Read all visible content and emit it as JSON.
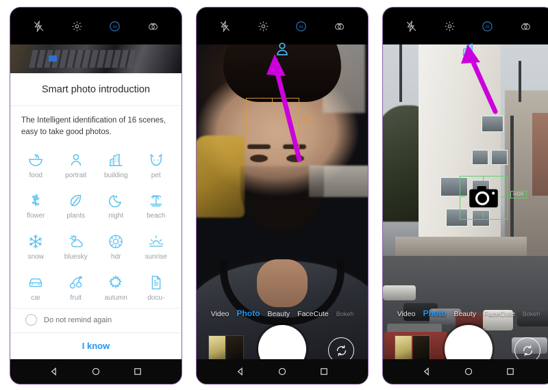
{
  "phones": {
    "p1": {
      "label": "smart-photo-introduction-dialog",
      "topbar": [
        {
          "name": "flash-off-icon",
          "label": "flash off"
        },
        {
          "name": "settings-gear-icon",
          "label": "settings"
        },
        {
          "name": "ai-scene-icon",
          "label": "AI"
        },
        {
          "name": "filter-icon",
          "label": "filters"
        }
      ],
      "dialog": {
        "title": "Smart photo introduction",
        "subtitle": "The Intelligent identification of 16 scenes, easy to take good photos.",
        "scenes": [
          {
            "label": "food",
            "icon": "bowl-icon"
          },
          {
            "label": "portrait",
            "icon": "person-icon"
          },
          {
            "label": "building",
            "icon": "building-icon"
          },
          {
            "label": "pet",
            "icon": "cat-icon"
          },
          {
            "label": "flower",
            "icon": "flower-icon"
          },
          {
            "label": "plants",
            "icon": "leaf-icon"
          },
          {
            "label": "night",
            "icon": "moon-icon"
          },
          {
            "label": "beach",
            "icon": "palm-icon"
          },
          {
            "label": "snow",
            "icon": "snowflake-icon"
          },
          {
            "label": "bluesky",
            "icon": "sun-cloud-icon"
          },
          {
            "label": "hdr",
            "icon": "hdr-icon"
          },
          {
            "label": "sunrise",
            "icon": "sunrise-icon"
          },
          {
            "label": "car",
            "icon": "car-icon"
          },
          {
            "label": "fruit",
            "icon": "cherry-icon"
          },
          {
            "label": "autumn",
            "icon": "maple-leaf-icon"
          },
          {
            "label": "docu-",
            "icon": "document-icon"
          }
        ],
        "remind_label": "Do not remind again",
        "confirm_label": "I know"
      }
    },
    "p2": {
      "label": "selfie-portrait-scene",
      "scene_badge": {
        "name": "portrait-scene-badge",
        "label": "portrait"
      },
      "modes": [
        {
          "label": "Video",
          "state": "normal"
        },
        {
          "label": "Photo",
          "state": "active"
        },
        {
          "label": "Beauty",
          "state": "normal"
        },
        {
          "label": "FaceCute",
          "state": "normal"
        },
        {
          "label": "Bokeh",
          "state": "dim"
        }
      ]
    },
    "p3": {
      "label": "building-scene",
      "scene_badge": {
        "name": "building-scene-badge",
        "label": "building"
      },
      "hdr_tag": "HDR",
      "modes": [
        {
          "label": "Video",
          "state": "normal"
        },
        {
          "label": "Photo",
          "state": "active"
        },
        {
          "label": "Beauty",
          "state": "normal"
        },
        {
          "label": "FaceCute",
          "state": "normal"
        },
        {
          "label": "Bokeh",
          "state": "dim"
        }
      ]
    }
  },
  "navbar": [
    {
      "name": "back-nav-icon",
      "label": "back"
    },
    {
      "name": "home-nav-icon",
      "label": "home"
    },
    {
      "name": "recents-nav-icon",
      "label": "recents"
    }
  ],
  "colors": {
    "accent_blue": "#2196f3",
    "scene_icon_blue": "#5bc0f0",
    "arrow_magenta": "#cc00dd",
    "focus_green": "#5fd36a",
    "face_amber": "#d79a3c",
    "frame_purple": "#8e5fa8"
  }
}
